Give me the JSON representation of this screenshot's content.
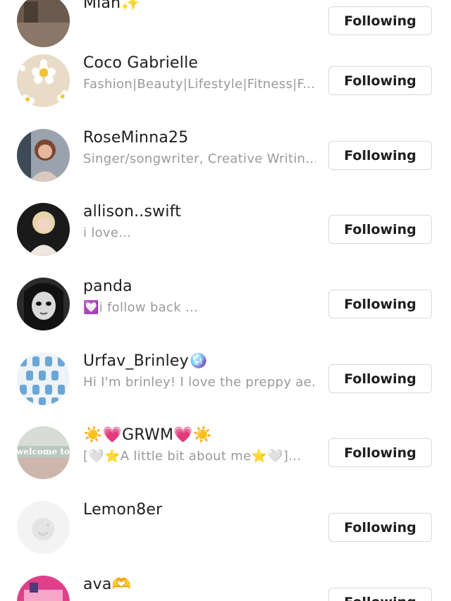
{
  "follow_label": "Following",
  "users": [
    {
      "name": "Miah✨",
      "bio": "",
      "avatar": "avatar-photo-dark"
    },
    {
      "name": "Coco Gabrielle",
      "bio": "Fashion|Beauty|Lifestyle|Fitness|F...",
      "avatar": "avatar-daisy"
    },
    {
      "name": "RoseMinna25",
      "bio": "Singer/songwriter, Creative Writin...",
      "avatar": "avatar-photo-girl"
    },
    {
      "name": "allison..swift",
      "bio": "i love...",
      "avatar": "avatar-photo-singer"
    },
    {
      "name": "panda",
      "bio": "💟i follow back ...",
      "avatar": "avatar-cartoon-girl"
    },
    {
      "name": "Urfav_Brinley🪩",
      "bio": "Hi I'm brinley! I love the preppy ae...",
      "avatar": "avatar-pattern"
    },
    {
      "name": "☀️💗GRWM💗☀️",
      "bio": "[🤍⭐A little bit about me⭐🤍]...",
      "avatar": "avatar-welcome-to"
    },
    {
      "name": "Lemon8er",
      "bio": "",
      "avatar": "avatar-default"
    },
    {
      "name": "ava🫶",
      "bio": "",
      "avatar": "avatar-pink-photo"
    }
  ],
  "colors": {
    "text": "#1e1e1e",
    "bio_text": "#9a9a9a",
    "button_border": "#d9d9d9",
    "background": "#ffffff"
  }
}
